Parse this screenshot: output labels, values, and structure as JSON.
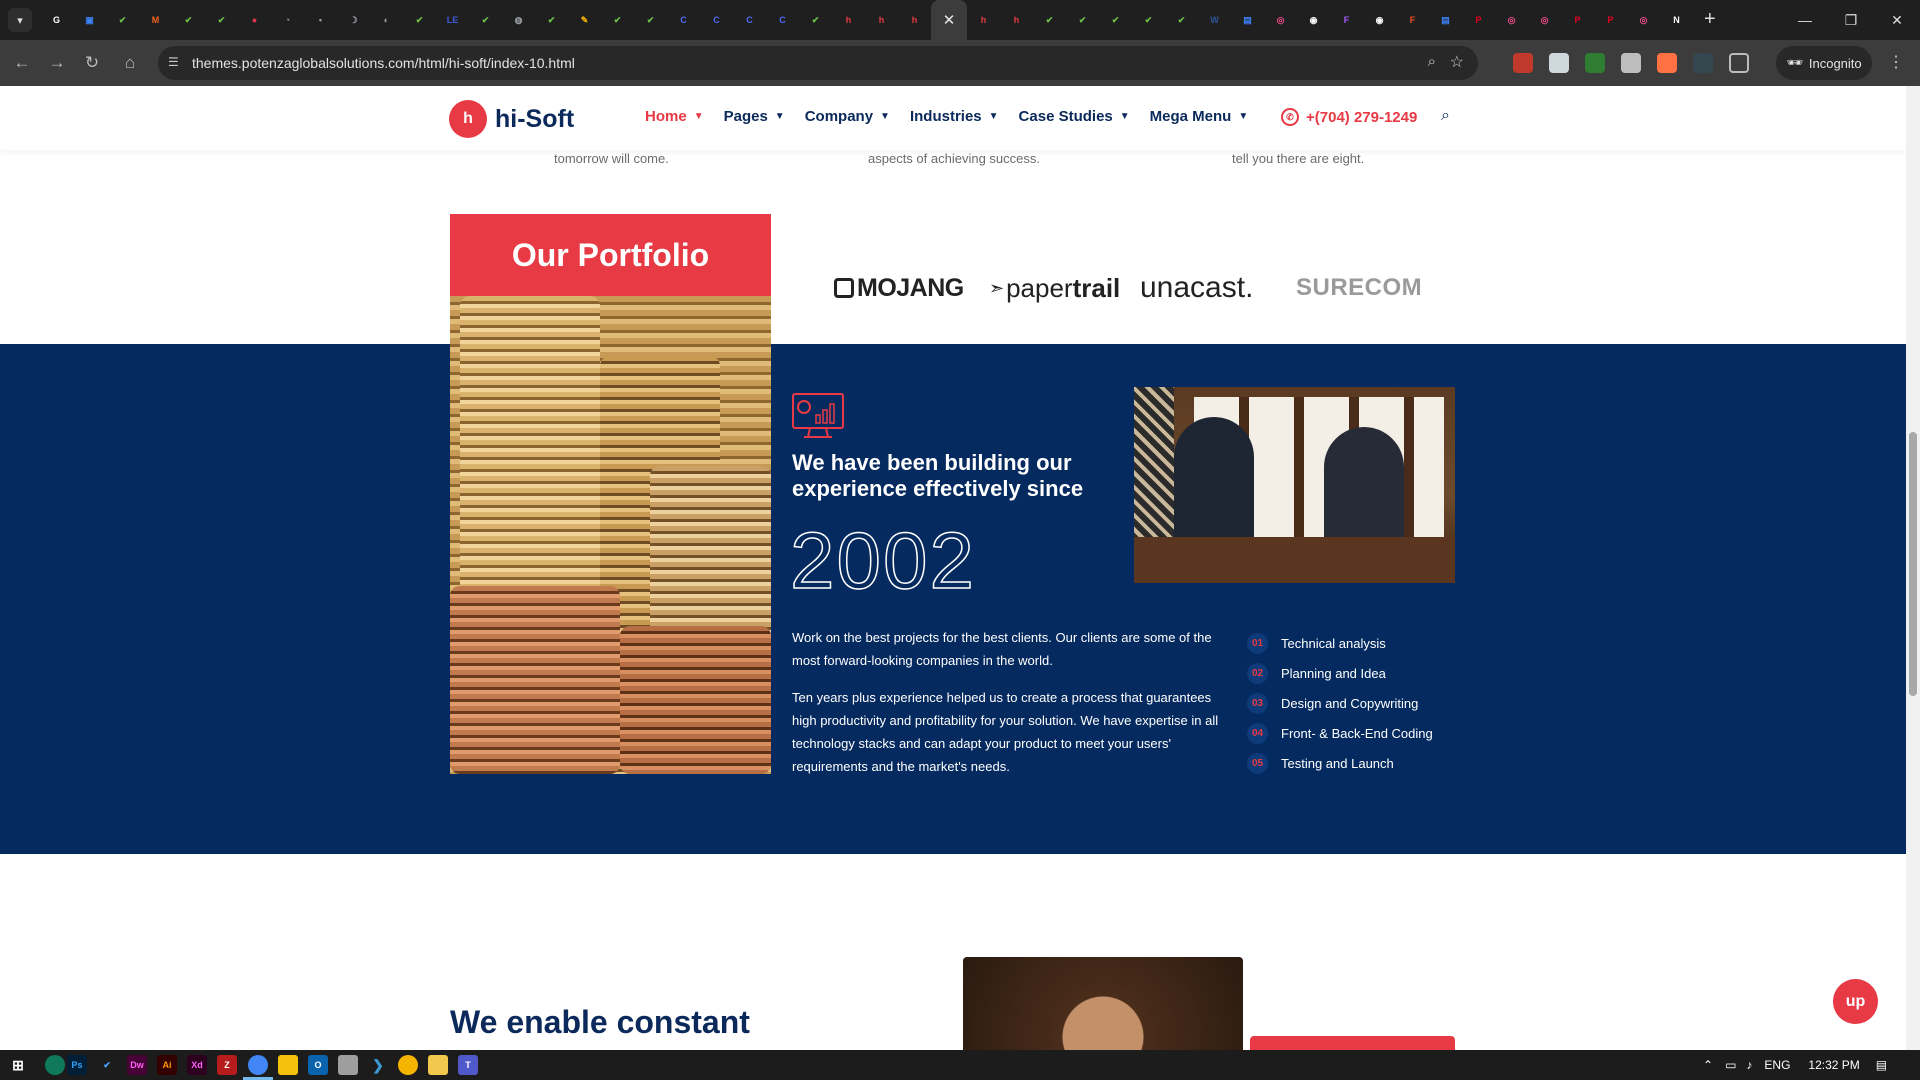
{
  "browser": {
    "url": "themes.potenzaglobalsolutions.com/html/hi-soft/index-10.html",
    "profile_label": "Incognito",
    "tab_favicons": [
      {
        "icon": "google-icon",
        "color": "#ffffff",
        "glyph": "G"
      },
      {
        "icon": "square-icon",
        "color": "#3b82f6",
        "glyph": "▣"
      },
      {
        "icon": "green-app-icon",
        "color": "#6cc04a",
        "glyph": "✔"
      },
      {
        "icon": "magento-icon",
        "color": "#f26322",
        "glyph": "M"
      },
      {
        "icon": "green-app-icon",
        "color": "#6cc04a",
        "glyph": "✔"
      },
      {
        "icon": "green-app-icon",
        "color": "#6cc04a",
        "glyph": "✔"
      },
      {
        "icon": "record-icon",
        "color": "#e8344a",
        "glyph": "●"
      },
      {
        "icon": "gauge-icon",
        "color": "#9aa0a6",
        "glyph": "◔"
      },
      {
        "icon": "bulb-icon",
        "color": "#9aa0a6",
        "glyph": "•"
      },
      {
        "icon": "moon-icon",
        "color": "#9aa0a6",
        "glyph": "☽"
      },
      {
        "icon": "circle-icon",
        "color": "#9aa0a6",
        "glyph": "◐"
      },
      {
        "icon": "green-app-icon",
        "color": "#6cc04a",
        "glyph": "✔"
      },
      {
        "icon": "le-icon",
        "color": "#3b5bdb",
        "glyph": "LE"
      },
      {
        "icon": "green-app-icon",
        "color": "#6cc04a",
        "glyph": "✔"
      },
      {
        "icon": "globe-icon",
        "color": "#9aa0a6",
        "glyph": "◍"
      },
      {
        "icon": "green-app-icon",
        "color": "#6cc04a",
        "glyph": "✔"
      },
      {
        "icon": "wrench-icon",
        "color": "#f4b400",
        "glyph": "✎"
      },
      {
        "icon": "green-app-icon",
        "color": "#6cc04a",
        "glyph": "✔"
      },
      {
        "icon": "green-app-icon",
        "color": "#6cc04a",
        "glyph": "✔"
      },
      {
        "icon": "c-app-icon",
        "color": "#4c6ef5",
        "glyph": "C"
      },
      {
        "icon": "c-app-icon",
        "color": "#4c6ef5",
        "glyph": "C"
      },
      {
        "icon": "c-app-icon",
        "color": "#4c6ef5",
        "glyph": "C"
      },
      {
        "icon": "c-app-icon",
        "color": "#4c6ef5",
        "glyph": "C"
      },
      {
        "icon": "green-app-icon",
        "color": "#6cc04a",
        "glyph": "✔"
      },
      {
        "icon": "hisoft-icon",
        "color": "#e83a45",
        "glyph": "h"
      },
      {
        "icon": "hisoft-icon",
        "color": "#e83a45",
        "glyph": "h"
      },
      {
        "icon": "hisoft-icon",
        "color": "#e83a45",
        "glyph": "h"
      },
      {
        "icon": "close-tab-icon",
        "color": "#e8e8e8",
        "glyph": "✕",
        "active": true
      },
      {
        "icon": "hisoft-icon",
        "color": "#e83a45",
        "glyph": "h"
      },
      {
        "icon": "hisoft-icon",
        "color": "#e83a45",
        "glyph": "h"
      },
      {
        "icon": "green-app-icon",
        "color": "#6cc04a",
        "glyph": "✔"
      },
      {
        "icon": "green-app-icon",
        "color": "#6cc04a",
        "glyph": "✔"
      },
      {
        "icon": "green-app-icon",
        "color": "#6cc04a",
        "glyph": "✔"
      },
      {
        "icon": "green-app-icon",
        "color": "#6cc04a",
        "glyph": "✔"
      },
      {
        "icon": "green-app-icon",
        "color": "#6cc04a",
        "glyph": "✔"
      },
      {
        "icon": "word-icon",
        "color": "#2b579a",
        "glyph": "W"
      },
      {
        "icon": "forms-icon",
        "color": "#3b82f6",
        "glyph": "▤"
      },
      {
        "icon": "dribbble-icon",
        "color": "#ea4c89",
        "glyph": "◎"
      },
      {
        "icon": "chrome-icon",
        "color": "#ffffff",
        "glyph": "◉"
      },
      {
        "icon": "figma-icon",
        "color": "#a259ff",
        "glyph": "F"
      },
      {
        "icon": "chrome-icon",
        "color": "#ffffff",
        "glyph": "◉"
      },
      {
        "icon": "figma-icon",
        "color": "#f24e1e",
        "glyph": "F"
      },
      {
        "icon": "forms-icon",
        "color": "#3b82f6",
        "glyph": "▤"
      },
      {
        "icon": "pinterest-icon",
        "color": "#e60023",
        "glyph": "P"
      },
      {
        "icon": "dribbble-icon",
        "color": "#ea4c89",
        "glyph": "◎"
      },
      {
        "icon": "dribbble-icon",
        "color": "#ea4c89",
        "glyph": "◎"
      },
      {
        "icon": "pinterest-icon",
        "color": "#e60023",
        "glyph": "P"
      },
      {
        "icon": "pinterest-icon",
        "color": "#e60023",
        "glyph": "P"
      },
      {
        "icon": "dribbble-icon",
        "color": "#ea4c89",
        "glyph": "◎"
      },
      {
        "icon": "notion-icon",
        "color": "#ffffff",
        "glyph": "N"
      }
    ]
  },
  "site": {
    "logo_text": "hi-Soft",
    "logo_mark": "h",
    "nav": [
      {
        "label": "Home",
        "active": true
      },
      {
        "label": "Pages"
      },
      {
        "label": "Company"
      },
      {
        "label": "Industries"
      },
      {
        "label": "Case Studies"
      },
      {
        "label": "Mega Menu"
      }
    ],
    "phone": "+(704) 279-1249",
    "prev_texts": [
      "tomorrow will come.",
      "aspects of achieving success.",
      "tell you there are eight."
    ],
    "portfolio_title": "Our Portfolio",
    "clients": {
      "mojang": "MOJANG",
      "papertrail_light": "paper",
      "papertrail_bold": "trail",
      "unacast": "unacast.",
      "surecom": "SURECOM"
    },
    "experience_title": "We have been building our experience effectively since",
    "year": "2002",
    "paragraph_1": "Work on the best projects for the best clients. Our clients are some of the most forward-looking companies in the world.",
    "paragraph_2": "Ten years plus experience helped us to create a process that guarantees high productivity and profitability for your solution. We have expertise in all technology stacks and can adapt your product to meet your users' requirements and the market's needs.",
    "steps": [
      {
        "num": "01",
        "label": "Technical analysis"
      },
      {
        "num": "02",
        "label": "Planning and Idea"
      },
      {
        "num": "03",
        "label": "Design and Copywriting"
      },
      {
        "num": "04",
        "label": "Front- & Back-End Coding"
      },
      {
        "num": "05",
        "label": "Testing and Launch"
      }
    ],
    "enable_title": "We enable constant",
    "up_label": "up",
    "colors": {
      "brand_red": "#e83a45",
      "navy": "#052a5f",
      "text_navy": "#0b2a5b"
    }
  },
  "taskbar": {
    "language": "ENG",
    "time": "12:32 PM"
  }
}
